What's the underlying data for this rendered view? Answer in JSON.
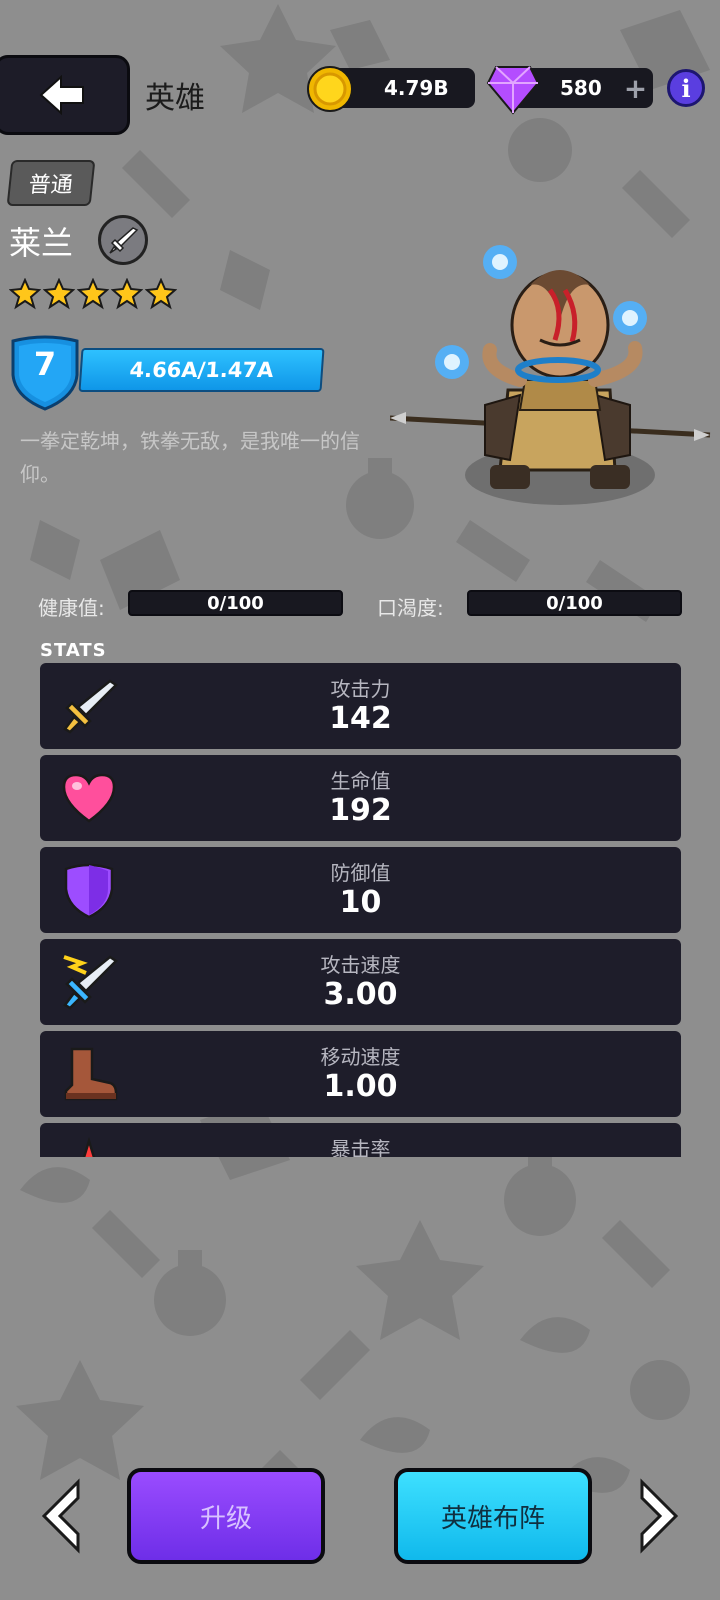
{
  "header": {
    "title": "英雄",
    "coins": "4.79B",
    "gems": "580",
    "gem_plus": "+",
    "info": "i"
  },
  "hero": {
    "rarity": "普通",
    "name": "莱兰",
    "stars": 5,
    "level": "7",
    "xp": "4.66A/1.47A",
    "description": "一拳定乾坤，铁拳无敌，是我唯一的信仰。"
  },
  "meters": {
    "health_label": "健康值:",
    "health_value": "0/100",
    "thirst_label": "口渴度:",
    "thirst_value": "0/100"
  },
  "stats": {
    "title": "STATS",
    "items": [
      {
        "label": "攻击力",
        "value": "142",
        "icon": "sword-icon"
      },
      {
        "label": "生命值",
        "value": "192",
        "icon": "heart-icon"
      },
      {
        "label": "防御值",
        "value": "10",
        "icon": "shield-icon"
      },
      {
        "label": "攻击速度",
        "value": "3.00",
        "icon": "speed-sword-icon"
      },
      {
        "label": "移动速度",
        "value": "1.00",
        "icon": "boot-icon"
      },
      {
        "label": "暴击率",
        "value": "",
        "icon": "crit-icon"
      }
    ]
  },
  "footer": {
    "upgrade": "升级",
    "formation": "英雄布阵"
  },
  "colors": {
    "background": "#8e8e8e",
    "panel": "#1e1d2a",
    "xp_bar": "#1aa8f2",
    "upgrade_button": "#7f3cf2",
    "formation_button": "#22c8f5"
  }
}
